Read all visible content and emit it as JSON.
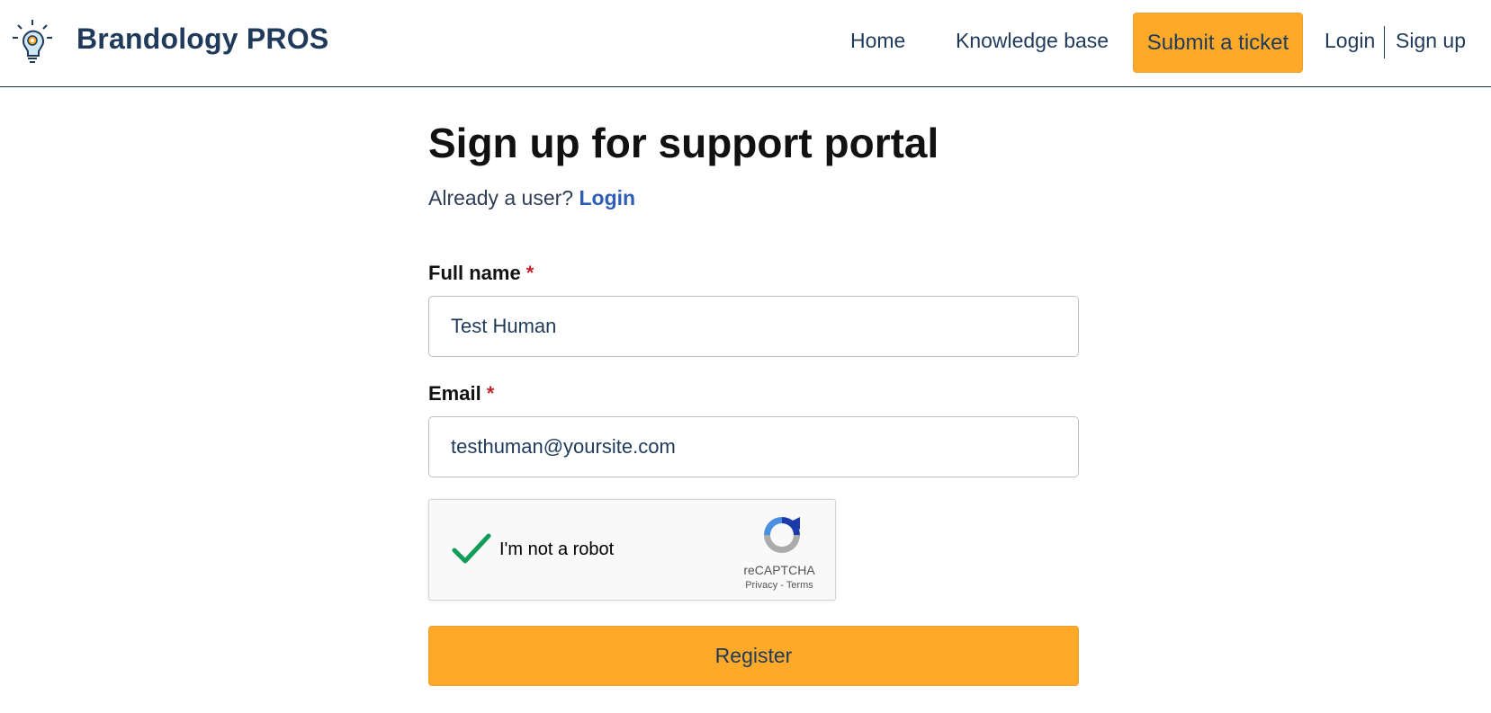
{
  "header": {
    "brand": "Brandology PROS",
    "nav": {
      "home": "Home",
      "knowledge_base": "Knowledge base",
      "submit_ticket": "Submit a ticket",
      "login": "Login",
      "signup": "Sign up"
    }
  },
  "main": {
    "title": "Sign up for support portal",
    "already_prefix": "Already a user? ",
    "already_link": "Login",
    "full_name": {
      "label": "Full name",
      "required": "*",
      "value": "Test Human"
    },
    "email": {
      "label": "Email",
      "required": "*",
      "value": "testhuman@yoursite.com"
    },
    "captcha": {
      "text": "I'm not a robot",
      "brand": "reCAPTCHA",
      "privacy": "Privacy",
      "separator": " - ",
      "terms": "Terms",
      "checked": true
    },
    "register_label": "Register"
  },
  "colors": {
    "accent": "#fea928",
    "link": "#2e5db7",
    "required": "#c0262d",
    "check": "#0f9d58"
  },
  "icons": {
    "logo": "lightbulb-gear-icon",
    "check": "checkmark-icon",
    "recaptcha": "recaptcha-logo-icon"
  }
}
